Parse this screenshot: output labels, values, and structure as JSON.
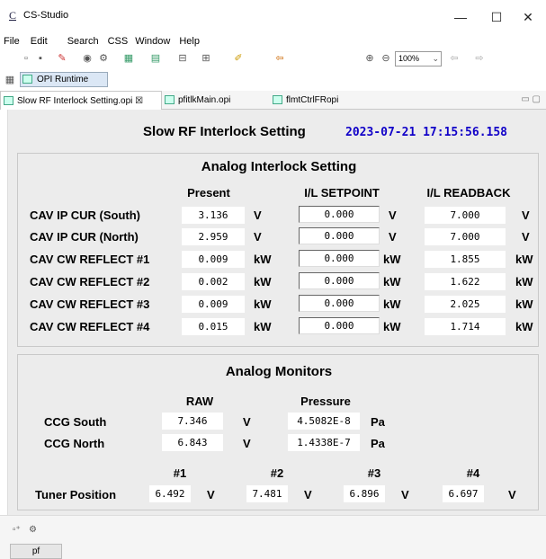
{
  "window": {
    "app_icon": "C",
    "title": "CS-Studio",
    "minimize": "—",
    "maximize": "☐",
    "close": "✕"
  },
  "menu": [
    "File",
    "Edit",
    "Search",
    "CSS",
    "Window",
    "Help"
  ],
  "toolbar": {
    "zoom": "100%"
  },
  "perspective": {
    "label": "OPI Runtime"
  },
  "tabs": [
    {
      "label": "Slow RF Interlock Setting.opi ☒",
      "active": true
    },
    {
      "label": "pfitlkMain.opi",
      "active": false
    },
    {
      "label": "flmtCtrlFRopi",
      "active": false
    }
  ],
  "screen": {
    "title": "Slow RF Interlock Setting",
    "timestamp": "2023-07-21 17:15:56.158"
  },
  "analog_interlock": {
    "title": "Analog Interlock Setting",
    "col_present": "Present",
    "col_setpoint": "I/L SETPOINT",
    "col_readback": "I/L READBACK",
    "rows": [
      {
        "label": "CAV IP CUR (South)",
        "present": "3.136",
        "unit": "V",
        "setpoint": "0.000",
        "readback": "7.000"
      },
      {
        "label": "CAV IP CUR (North)",
        "present": "2.959",
        "unit": "V",
        "setpoint": "0.000",
        "readback": "7.000"
      },
      {
        "label": "CAV CW REFLECT #1",
        "present": "0.009",
        "unit": "kW",
        "setpoint": "0.000",
        "readback": "1.855"
      },
      {
        "label": "CAV CW REFLECT #2",
        "present": "0.002",
        "unit": "kW",
        "setpoint": "0.000",
        "readback": "1.622"
      },
      {
        "label": "CAV CW REFLECT #3",
        "present": "0.009",
        "unit": "kW",
        "setpoint": "0.000",
        "readback": "2.025"
      },
      {
        "label": "CAV CW REFLECT #4",
        "present": "0.015",
        "unit": "kW",
        "setpoint": "0.000",
        "readback": "1.714"
      }
    ]
  },
  "analog_monitors": {
    "title": "Analog Monitors",
    "col_raw": "RAW",
    "col_pressure": "Pressure",
    "rows": [
      {
        "label": "CCG South",
        "raw": "7.346",
        "raw_unit": "V",
        "pressure": "4.5082E-8",
        "pressure_unit": "Pa"
      },
      {
        "label": "CCG North",
        "raw": "6.843",
        "raw_unit": "V",
        "pressure": "1.4338E-7",
        "pressure_unit": "Pa"
      }
    ],
    "tuner": {
      "label": "Tuner Position",
      "headers": [
        "#1",
        "#2",
        "#3",
        "#4"
      ],
      "values": [
        "6.492",
        "7.481",
        "6.896",
        "6.697"
      ],
      "unit": "V"
    }
  },
  "bottom_tab": "pf"
}
